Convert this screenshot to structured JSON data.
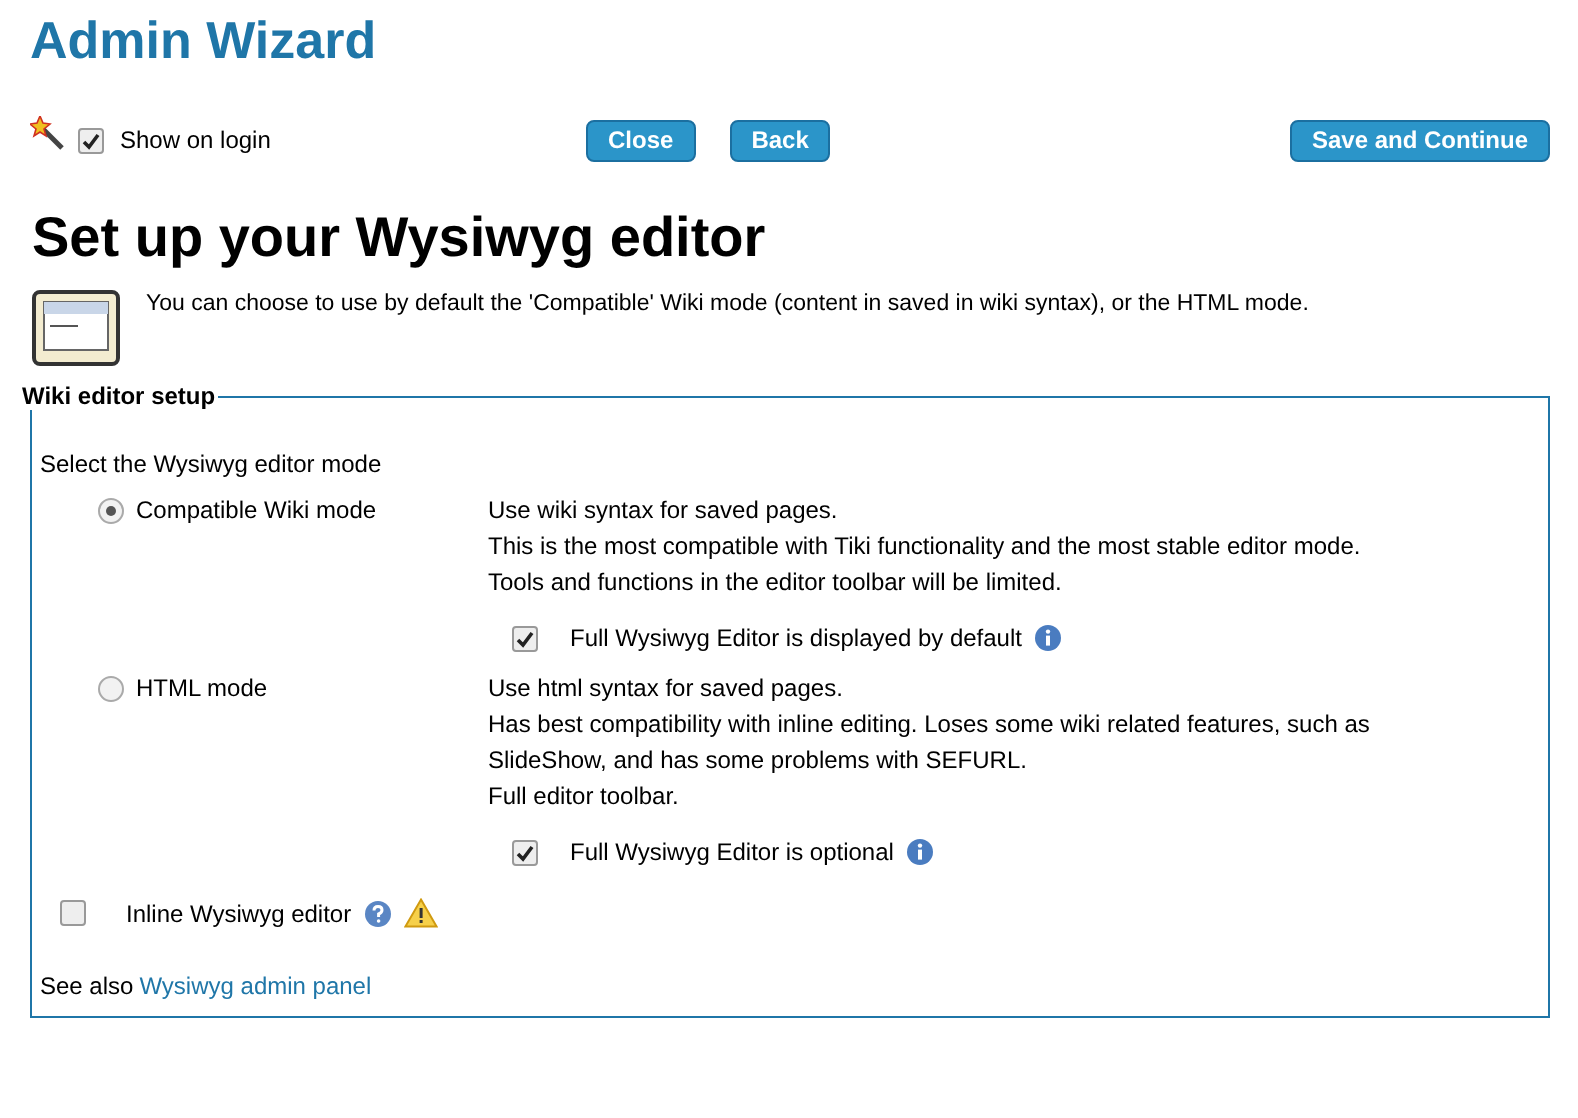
{
  "title": "Admin Wizard",
  "toolbar": {
    "show_on_login": {
      "label": "Show on login",
      "checked": true
    },
    "buttons": [
      {
        "label": "Close",
        "kind": "left"
      },
      {
        "label": "Back",
        "kind": "left"
      },
      {
        "label": "Save and Continue",
        "kind": "right"
      }
    ]
  },
  "heading": "Set up your Wysiwyg editor",
  "intro": "You can choose to use by default the 'Compatible' Wiki mode (content in saved in wiki syntax), or the HTML mode.",
  "fieldset": {
    "legend": "Wiki editor setup",
    "prompt": "Select the Wysiwyg editor mode",
    "modes": [
      {
        "label": "Compatible Wiki mode",
        "selected": true,
        "lines": [
          "Use wiki syntax for saved pages.",
          "This is the most compatible with Tiki functionality and the most stable editor mode.",
          "Tools and functions in the editor toolbar will be limited."
        ],
        "option": {
          "label": "Full Wysiwyg Editor is displayed by default",
          "checked": true
        }
      },
      {
        "label": "HTML mode",
        "selected": false,
        "lines": [
          "Use html syntax for saved pages.",
          "Has best compatibility with inline editing. Loses some wiki related features, such as",
          "SlideShow, and has some problems with SEFURL.",
          "Full editor toolbar."
        ],
        "option": {
          "label": "Full Wysiwyg Editor is optional",
          "checked": true
        }
      }
    ],
    "inline": {
      "label": "Inline Wysiwyg editor",
      "checked": false
    },
    "see_also": {
      "text": "See also",
      "link": "Wysiwyg admin panel"
    }
  }
}
